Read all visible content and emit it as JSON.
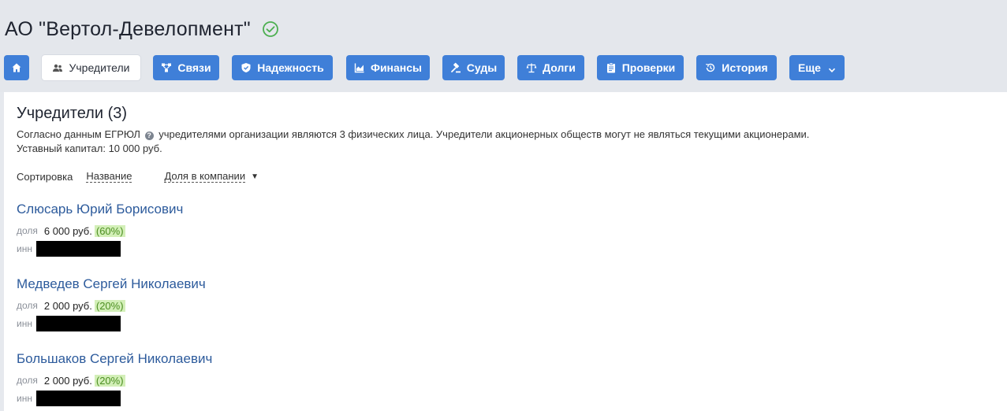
{
  "company": {
    "title": "АО \"Вертол-Девелопмент\""
  },
  "tabs": [
    {
      "label": "",
      "icon": "home-icon"
    },
    {
      "label": "Учредители",
      "icon": "users-icon"
    },
    {
      "label": "Связи",
      "icon": "network-icon"
    },
    {
      "label": "Надежность",
      "icon": "shield-icon"
    },
    {
      "label": "Финансы",
      "icon": "chart-icon"
    },
    {
      "label": "Суды",
      "icon": "gavel-icon"
    },
    {
      "label": "Долги",
      "icon": "scales-icon"
    },
    {
      "label": "Проверки",
      "icon": "clipboard-icon"
    },
    {
      "label": "История",
      "icon": "history-icon"
    },
    {
      "label": "Еще",
      "icon": "chevron-down-icon"
    }
  ],
  "founders_section": {
    "title": "Учредители (3)",
    "desc_before": "Согласно данным ЕГРЮЛ",
    "desc_after": "учредителями организации являются 3 физических лица. Учредители акционерных обществ могут не являться текущими акционерами.",
    "capital": "Уставный капитал: 10 000 руб.",
    "sort_label": "Сортировка",
    "sort_by_name": "Название",
    "sort_by_share": "Доля в компании",
    "share_label": "доля",
    "inn_label": "инн"
  },
  "founders": [
    {
      "name": "Слюсарь Юрий Борисович",
      "share": "6 000 руб.",
      "percent": "(60%)"
    },
    {
      "name": "Медведев Сергей Николаевич",
      "share": "2 000 руб.",
      "percent": "(20%)"
    },
    {
      "name": "Большаков Сергей Николаевич",
      "share": "2 000 руб.",
      "percent": "(20%)"
    }
  ],
  "colors": {
    "accent": "#3f7fd8",
    "link": "#2d5b9c",
    "verified": "#4caf50",
    "percent_bg": "#d3efb8"
  }
}
